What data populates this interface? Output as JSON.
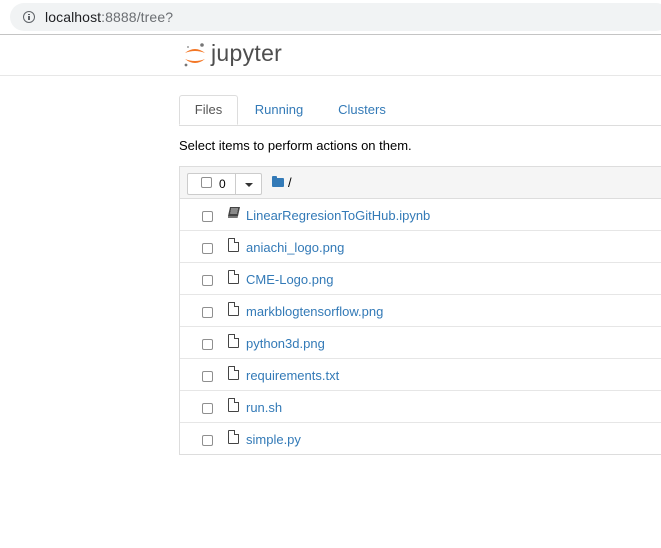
{
  "browser": {
    "url_host": "localhost",
    "url_rest": ":8888/tree?"
  },
  "header": {
    "brand": "jupyter"
  },
  "tabs": [
    {
      "label": "Files",
      "active": true
    },
    {
      "label": "Running",
      "active": false
    },
    {
      "label": "Clusters",
      "active": false
    }
  ],
  "instructions": "Select items to perform actions on them.",
  "list_header": {
    "selected_count": "0",
    "path": "/"
  },
  "files": [
    {
      "name": "LinearRegresionToGitHub.ipynb",
      "icon": "notebook-icon"
    },
    {
      "name": "aniachi_logo.png",
      "icon": "file-icon"
    },
    {
      "name": "CME-Logo.png",
      "icon": "file-icon"
    },
    {
      "name": "markblogtensorflow.png",
      "icon": "file-icon"
    },
    {
      "name": "python3d.png",
      "icon": "file-icon"
    },
    {
      "name": "requirements.txt",
      "icon": "file-icon"
    },
    {
      "name": "run.sh",
      "icon": "file-icon"
    },
    {
      "name": "simple.py",
      "icon": "file-icon"
    }
  ],
  "colors": {
    "link": "#337ab7",
    "logo_orange": "#f37726"
  }
}
